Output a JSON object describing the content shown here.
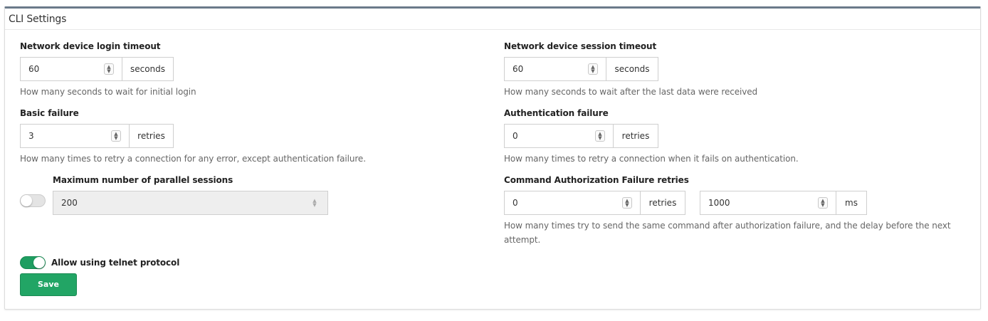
{
  "panel": {
    "title": "CLI Settings"
  },
  "login_timeout": {
    "label": "Network device login timeout",
    "value": "60",
    "unit": "seconds",
    "help": "How many seconds to wait for initial login"
  },
  "session_timeout": {
    "label": "Network device session timeout",
    "value": "60",
    "unit": "seconds",
    "help": "How many seconds to wait after the last data were received"
  },
  "basic_failure": {
    "label": "Basic failure",
    "value": "3",
    "unit": "retries",
    "help": "How many times to retry a connection for any error, except authentication failure."
  },
  "auth_failure": {
    "label": "Authentication failure",
    "value": "0",
    "unit": "retries",
    "help": "How many times to retry a connection when it fails on authentication."
  },
  "parallel_sessions": {
    "label": "Maximum number of parallel sessions",
    "value": "200",
    "enabled": false
  },
  "cmd_auth_failure": {
    "label": "Command Authorization Failure retries",
    "retries_value": "0",
    "retries_unit": "retries",
    "delay_value": "1000",
    "delay_unit": "ms",
    "help": "How many times try to send the same command after authorization failure, and the delay before the next attempt."
  },
  "telnet": {
    "label": "Allow using telnet protocol",
    "enabled": true
  },
  "actions": {
    "save_label": "Save"
  },
  "colors": {
    "accent": "#22a565",
    "panel_top_border": "#6b7a8a"
  }
}
